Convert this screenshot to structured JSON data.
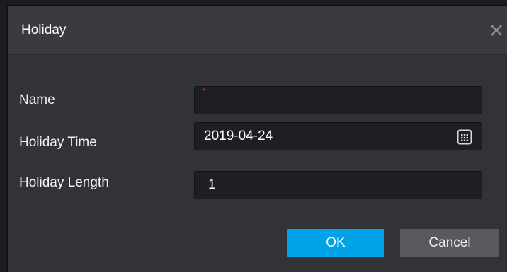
{
  "dialog": {
    "title": "Holiday",
    "close_icon": "close-icon"
  },
  "form": {
    "name": {
      "label": "Name",
      "value": "",
      "required_marker": "*"
    },
    "holiday_time": {
      "label": "Holiday Time",
      "value": "2019-04-24",
      "icon": "calendar-icon"
    },
    "holiday_length": {
      "label": "Holiday Length",
      "value": "1"
    }
  },
  "buttons": {
    "ok_label": "OK",
    "cancel_label": "Cancel"
  },
  "colors": {
    "ok_button": "#00a2e8",
    "cancel_button": "#58595c",
    "required_marker": "#e02020"
  }
}
